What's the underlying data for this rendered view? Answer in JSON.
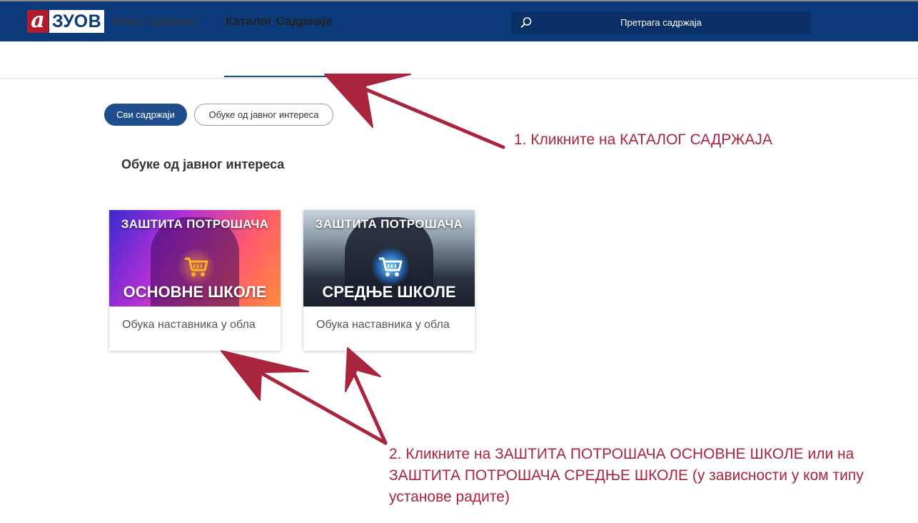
{
  "header": {
    "logo_mark": "а",
    "logo_text": "ЗУОВ",
    "search_placeholder": "Претрага садржаја",
    "search_icon": "search-icon",
    "bg_color": "#0d3a7a"
  },
  "tabs": [
    {
      "label": "Моји Садржаји",
      "active": false
    },
    {
      "label": "Каталог Садржаја",
      "active": true
    }
  ],
  "filters": [
    {
      "label": "Сви садржаји",
      "active": true
    },
    {
      "label": "Обуке од јавног интереса",
      "active": false
    }
  ],
  "section_title": "Обуке од јавног интереса",
  "cards": [
    {
      "top_text": "ЗАШТИТА ПОТРОШАЧА",
      "bottom_text": "ОСНОВНЕ ШКОЛЕ",
      "description": "Обука наставника у обла"
    },
    {
      "top_text": "ЗАШТИТА ПОТРОШАЧА",
      "bottom_text": "СРЕДЊЕ ШКОЛЕ",
      "description": "Обука наставника у обла"
    }
  ],
  "annotations": {
    "note1": "1. Кликните на КАТАЛОГ САДРЖАЈА",
    "note2": "2. Кликните на ЗАШТИТА ПОТРОШАЧА ОСНОВНЕ ШКОЛЕ или на ЗАШТИТА ПОТРОШАЧА СРЕДЊЕ ШКОЛЕ (у зависности у ком типу установе радите)",
    "color": "#a8253d"
  },
  "colors": {
    "accent": "#1e4f8c",
    "annotation": "#a8253d"
  }
}
